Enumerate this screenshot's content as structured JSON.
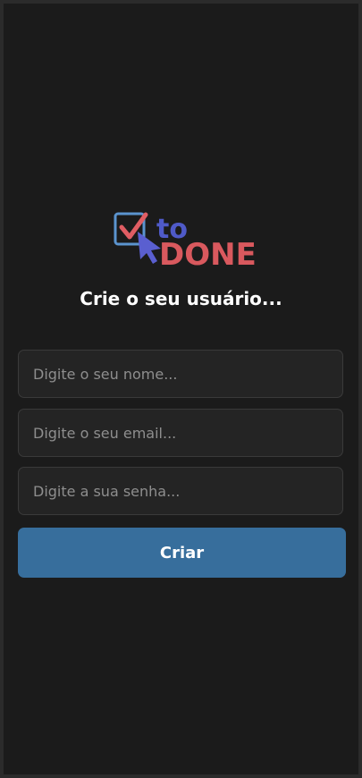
{
  "logo": {
    "word_top": "to",
    "word_bottom": "DONE",
    "colors": {
      "box": "#5b94cf",
      "check": "#e05d63",
      "cursor": "#5a5fd0",
      "to_text": "#4f5ac8",
      "done_text": "#d9595e"
    }
  },
  "title": "Crie o seu usuário...",
  "form": {
    "name_placeholder": "Digite o seu nome...",
    "email_placeholder": "Digite o seu email...",
    "password_placeholder": "Digite a sua senha...",
    "submit_label": "Criar"
  },
  "colors": {
    "background": "#1b1b1b",
    "input_background": "#242424",
    "button": "#376e9c"
  }
}
